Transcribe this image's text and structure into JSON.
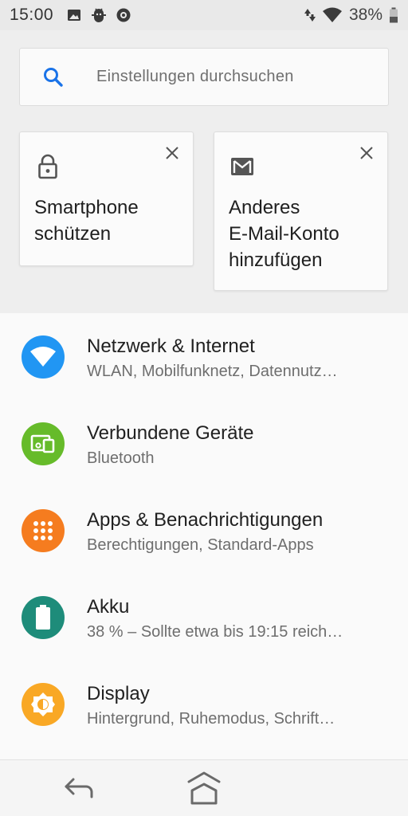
{
  "status_bar": {
    "time": "15:00",
    "left_icons": [
      "image-icon",
      "android-debug-icon",
      "record-icon"
    ],
    "right_icons": [
      "data-transfer-icon",
      "wifi-icon"
    ],
    "battery_percent": "38%"
  },
  "search": {
    "placeholder": "Einstellungen durchsuchen",
    "icon": "search-icon",
    "icon_color": "#1a73e8"
  },
  "suggestions": [
    {
      "title": "Smartphone\nschützen",
      "icon": "lock-icon"
    },
    {
      "title": "Anderes\nE-Mail-Konto\nhinzufügen",
      "icon": "gmail-icon"
    }
  ],
  "settings": [
    {
      "title": "Netzwerk & Internet",
      "summary": "WLAN, Mobilfunknetz, Datennutz…",
      "icon": "wifi-icon",
      "color": "#2196f3"
    },
    {
      "title": "Verbundene Geräte",
      "summary": "Bluetooth",
      "icon": "devices-icon",
      "color": "#66bb2a"
    },
    {
      "title": "Apps & Benachrichtigungen",
      "summary": "Berechtigungen, Standard-Apps",
      "icon": "apps-grid-icon",
      "color": "#f57c1f"
    },
    {
      "title": "Akku",
      "summary": "38 % – Sollte etwa bis 19:15 reich…",
      "icon": "battery-icon",
      "color": "#1e8c7a"
    },
    {
      "title": "Display",
      "summary": "Hintergrund, Ruhemodus, Schrift…",
      "icon": "brightness-icon",
      "color": "#f9a825"
    }
  ],
  "nav_bar": {
    "back_icon": "back-arrow-icon",
    "home_icon": "home-icon"
  }
}
